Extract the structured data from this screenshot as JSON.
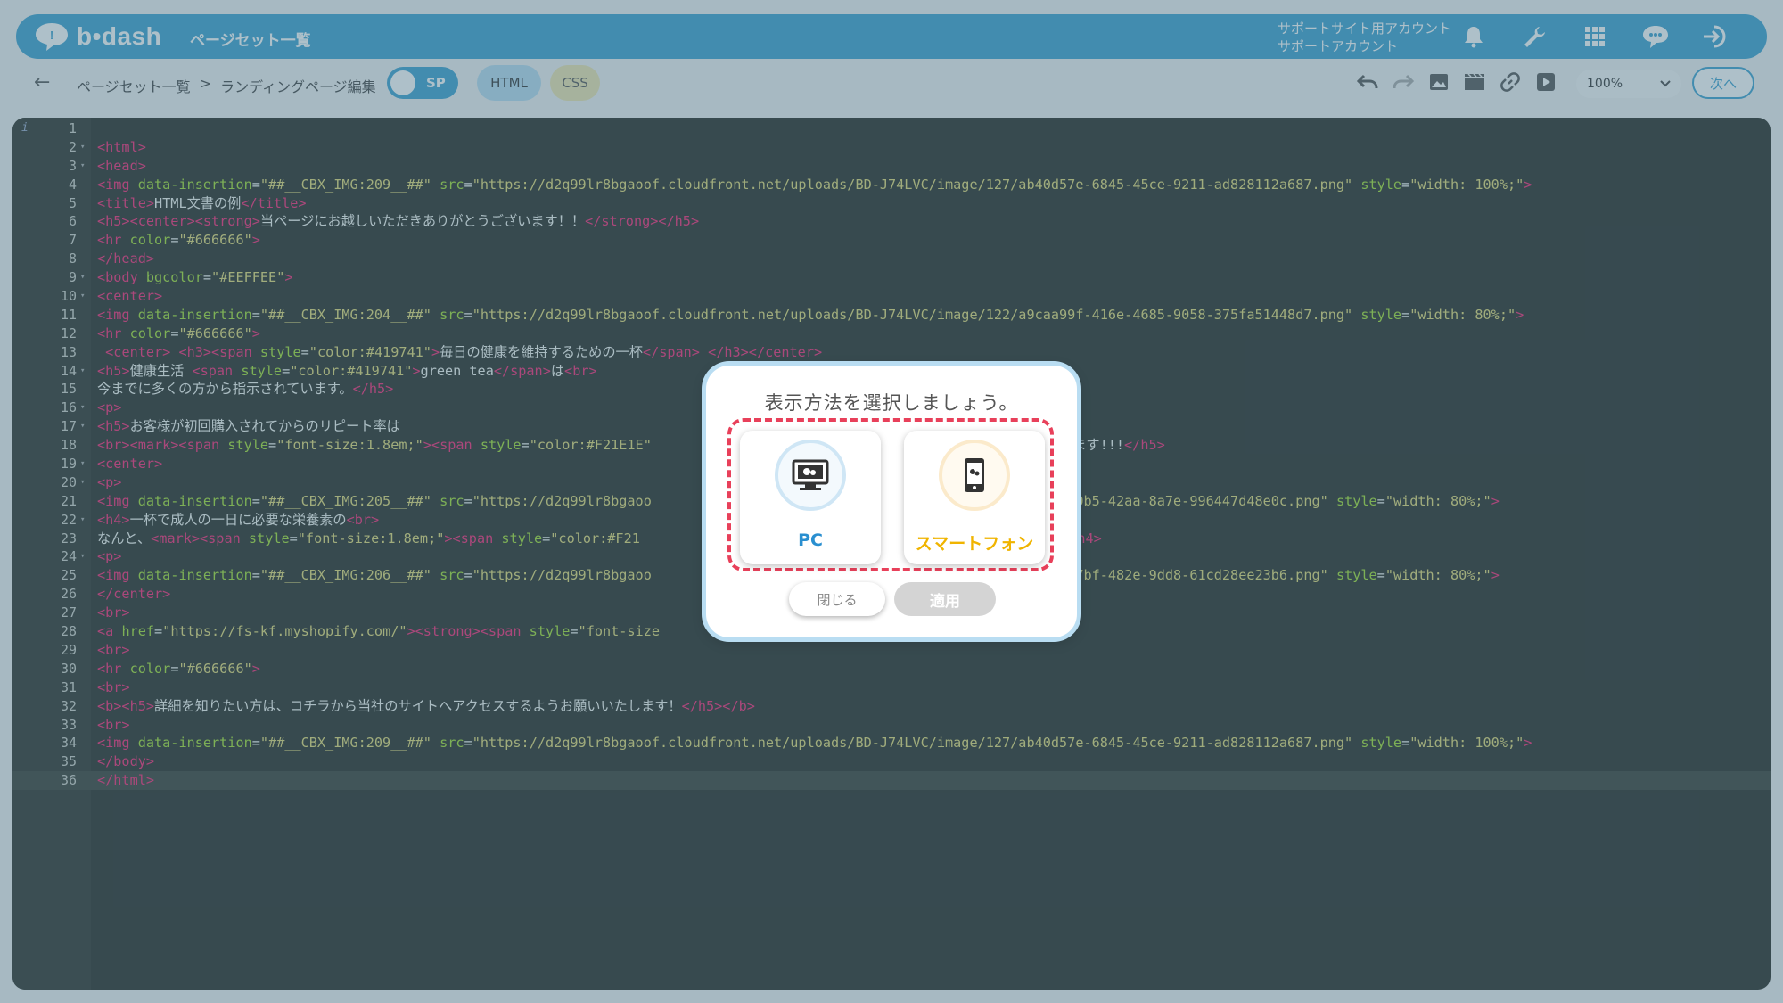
{
  "header": {
    "logo_text": "b•dash",
    "page_title": "ページセット一覧",
    "account_line1": "サポートサイト用アカウント",
    "account_line2": "サポートアカウント",
    "icons": [
      "bell-icon",
      "wrench-icon",
      "grid-icon",
      "chat-icon",
      "logout-icon"
    ]
  },
  "toolbar": {
    "back_icon": "←",
    "breadcrumb": [
      "ページセット一覧",
      ">",
      "ランディングページ編集"
    ],
    "toggle_label": "SP",
    "tab_html": "HTML",
    "tab_css": "CSS",
    "tools": [
      "undo-icon",
      "redo-icon",
      "image-icon",
      "video-icon",
      "link-icon",
      "play-icon"
    ],
    "zoom_value": "100%",
    "next_label": "次へ"
  },
  "editor": {
    "lines": [
      {
        "n": "1",
        "fold": false,
        "html": ""
      },
      {
        "n": "2",
        "fold": true,
        "html": "<span class='t'>&lt;html&gt;</span>"
      },
      {
        "n": "3",
        "fold": true,
        "html": "<span class='t'>&lt;head&gt;</span>"
      },
      {
        "n": "4",
        "fold": false,
        "html": "<span class='t'>&lt;img</span> <span class='a'>data-insertion</span>=<span class='s'>\"##__CBX_IMG:209__##\"</span> <span class='a'>src</span>=<span class='s'>\"https://d2q99lr8bgaoof.cloudfront.net/uploads/BD-J74LVC/image/127/ab40d57e-6845-45ce-9211-ad828112a687.png\"</span> <span class='a'>style</span>=<span class='s'>\"width: 100%;\"</span><span class='t'>&gt;</span>"
      },
      {
        "n": "5",
        "fold": false,
        "html": "<span class='t'>&lt;title&gt;</span>HTML文書の例<span class='t'>&lt;/title&gt;</span>"
      },
      {
        "n": "6",
        "fold": false,
        "html": "<span class='t'>&lt;h5&gt;&lt;center&gt;&lt;strong&gt;</span>当ページにお越しいただきありがとうございます！！<span class='t'>&lt;/strong&gt;&lt;/h5&gt;</span>"
      },
      {
        "n": "7",
        "fold": false,
        "html": "<span class='t'>&lt;hr</span> <span class='a'>color</span>=<span class='s'>\"#666666\"</span><span class='t'>&gt;</span>"
      },
      {
        "n": "8",
        "fold": false,
        "html": "<span class='t'>&lt;/head&gt;</span>"
      },
      {
        "n": "9",
        "fold": true,
        "html": "<span class='t'>&lt;body</span> <span class='a'>bgcolor</span>=<span class='s'>\"#EEFFEE\"</span><span class='t'>&gt;</span>"
      },
      {
        "n": "10",
        "fold": true,
        "html": "<span class='t'>&lt;center&gt;</span>"
      },
      {
        "n": "11",
        "fold": false,
        "html": "<span class='t'>&lt;img</span> <span class='a'>data-insertion</span>=<span class='s'>\"##__CBX_IMG:204__##\"</span> <span class='a'>src</span>=<span class='s'>\"https://d2q99lr8bgaoof.cloudfront.net/uploads/BD-J74LVC/image/122/a9caa99f-416e-4685-9058-375fa51448d7.png\"</span> <span class='a'>style</span>=<span class='s'>\"width: 80%;\"</span><span class='t'>&gt;</span>"
      },
      {
        "n": "12",
        "fold": false,
        "html": "<span class='t'>&lt;hr</span> <span class='a'>color</span>=<span class='s'>\"#666666\"</span><span class='t'>&gt;</span>"
      },
      {
        "n": "13",
        "fold": false,
        "html": " <span class='t'>&lt;center&gt;</span> <span class='t'>&lt;h3&gt;&lt;span</span> <span class='a'>style</span>=<span class='s'>\"color:#419741\"</span><span class='t'>&gt;</span>毎日の健康を維持するための一杯<span class='t'>&lt;/span&gt;</span> <span class='t'>&lt;/h3&gt;&lt;/center&gt;</span>"
      },
      {
        "n": "14",
        "fold": true,
        "html": "<span class='t'>&lt;h5&gt;</span>健康生活 <span class='t'>&lt;span</span> <span class='a'>style</span>=<span class='s'>\"color:#419741\"</span><span class='t'>&gt;</span>green tea<span class='t'>&lt;/span&gt;</span>は<span class='t'>&lt;br&gt;</span>"
      },
      {
        "n": "15",
        "fold": false,
        "html": "今までに多くの方から指示されています。<span class='t'>&lt;/h5&gt;</span>"
      },
      {
        "n": "16",
        "fold": true,
        "html": "<span class='t'>&lt;p&gt;</span>"
      },
      {
        "n": "17",
        "fold": true,
        "html": "<span class='t'>&lt;h5&gt;</span>お客様が初回購入されてからのリピート率は"
      },
      {
        "n": "18",
        "fold": false,
        "html": "<span class='t'>&lt;br&gt;&lt;mark&gt;&lt;span</span> <span class='a'>style</span>=<span class='s'>\"font-size:1.8em;\"</span><span class='t'>&gt;&lt;span</span> <span class='a'>style</span>=<span class='s'>\"color:#F21E1E\"</span>                                                  います!!!<span class='t'>&lt;/h5&gt;</span>"
      },
      {
        "n": "19",
        "fold": true,
        "html": "<span class='t'>&lt;center&gt;</span>"
      },
      {
        "n": "20",
        "fold": true,
        "html": "<span class='t'>&lt;p&gt;</span>"
      },
      {
        "n": "21",
        "fold": false,
        "html": "<span class='t'>&lt;img</span> <span class='a'>data-insertion</span>=<span class='s'>\"##__CBX_IMG:205__##\"</span> <span class='a'>src</span>=<span class='s'>\"https://d2q99lr8bgaoo                                       23/3593ca3e-30b5-42aa-8a7e-996447d48e0c.png\"</span> <span class='a'>style</span>=<span class='s'>\"width: 80%;\"</span><span class='t'>&gt;</span>"
      },
      {
        "n": "22",
        "fold": true,
        "html": "<span class='t'>&lt;h4&gt;</span>一杯で成人の一日に必要な栄養素の<span class='t'>&lt;br&gt;</span>"
      },
      {
        "n": "23",
        "fold": false,
        "html": "なんと、<span class='t'>&lt;mark&gt;&lt;span</span> <span class='a'>style</span>=<span class='s'>\"font-size:1.8em;\"</span><span class='t'>&gt;&lt;span</span> <span class='a'>style</span>=<span class='s'>\"color:#F21</span>                                          出来ます!!!<span class='t'>&lt;/h4&gt;</span>"
      },
      {
        "n": "24",
        "fold": true,
        "html": "<span class='t'>&lt;p&gt;</span>"
      },
      {
        "n": "25",
        "fold": false,
        "html": "<span class='t'>&lt;img</span> <span class='a'>data-insertion</span>=<span class='s'>\"##__CBX_IMG:206__##\"</span> <span class='a'>src</span>=<span class='s'>\"https://d2q99lr8bgaoo                                       24/2aec91f5-f7bf-482e-9dd8-61cd28ee23b6.png\"</span> <span class='a'>style</span>=<span class='s'>\"width: 80%;\"</span><span class='t'>&gt;</span>"
      },
      {
        "n": "26",
        "fold": false,
        "html": "<span class='t'>&lt;/center&gt;</span>"
      },
      {
        "n": "27",
        "fold": false,
        "html": "<span class='t'>&lt;br&gt;</span>"
      },
      {
        "n": "28",
        "fold": false,
        "html": "<span class='t'>&lt;a</span> <span class='a'>href</span>=<span class='s'>\"https://fs-kf.myshopify.com/\"</span><span class='t'>&gt;&lt;strong&gt;&lt;span</span> <span class='a'>style</span>=<span class='s'>\"font-size</span>                                        <span class='t'>&gt;&lt;/a&gt;</span>"
      },
      {
        "n": "29",
        "fold": false,
        "html": "<span class='t'>&lt;br&gt;</span>"
      },
      {
        "n": "30",
        "fold": false,
        "html": "<span class='t'>&lt;hr</span> <span class='a'>color</span>=<span class='s'>\"#666666\"</span><span class='t'>&gt;</span>"
      },
      {
        "n": "31",
        "fold": false,
        "html": "<span class='t'>&lt;br&gt;</span>"
      },
      {
        "n": "32",
        "fold": false,
        "html": "<span class='t'>&lt;b&gt;&lt;h5&gt;</span>詳細を知りたい方は、コチラから当社のサイトへアクセスするようお願いいたします！<span class='t'>&lt;/h5&gt;&lt;/b&gt;</span>"
      },
      {
        "n": "33",
        "fold": false,
        "html": "<span class='t'>&lt;br&gt;</span>"
      },
      {
        "n": "34",
        "fold": false,
        "html": "<span class='t'>&lt;img</span> <span class='a'>data-insertion</span>=<span class='s'>\"##__CBX_IMG:209__##\"</span> <span class='a'>src</span>=<span class='s'>\"https://d2q99lr8bgaoof.cloudfront.net/uploads/BD-J74LVC/image/127/ab40d57e-6845-45ce-9211-ad828112a687.png\"</span> <span class='a'>style</span>=<span class='s'>\"width: 100%;\"</span><span class='t'>&gt;</span>"
      },
      {
        "n": "35",
        "fold": false,
        "html": "<span class='t'>&lt;/body&gt;</span>"
      },
      {
        "n": "36",
        "fold": false,
        "html": "<span class='t'>&lt;/html&gt;</span>"
      }
    ]
  },
  "modal": {
    "title": "表示方法を選択しましょう。",
    "option_pc": "PC",
    "option_sp": "スマートフォン",
    "close_label": "閉じる",
    "apply_label": "適用"
  },
  "colors": {
    "brand": "#3ba0cf",
    "pc_label": "#2a8fd0",
    "sp_label": "#f0b400",
    "highlight_dash": "#e8405a"
  }
}
